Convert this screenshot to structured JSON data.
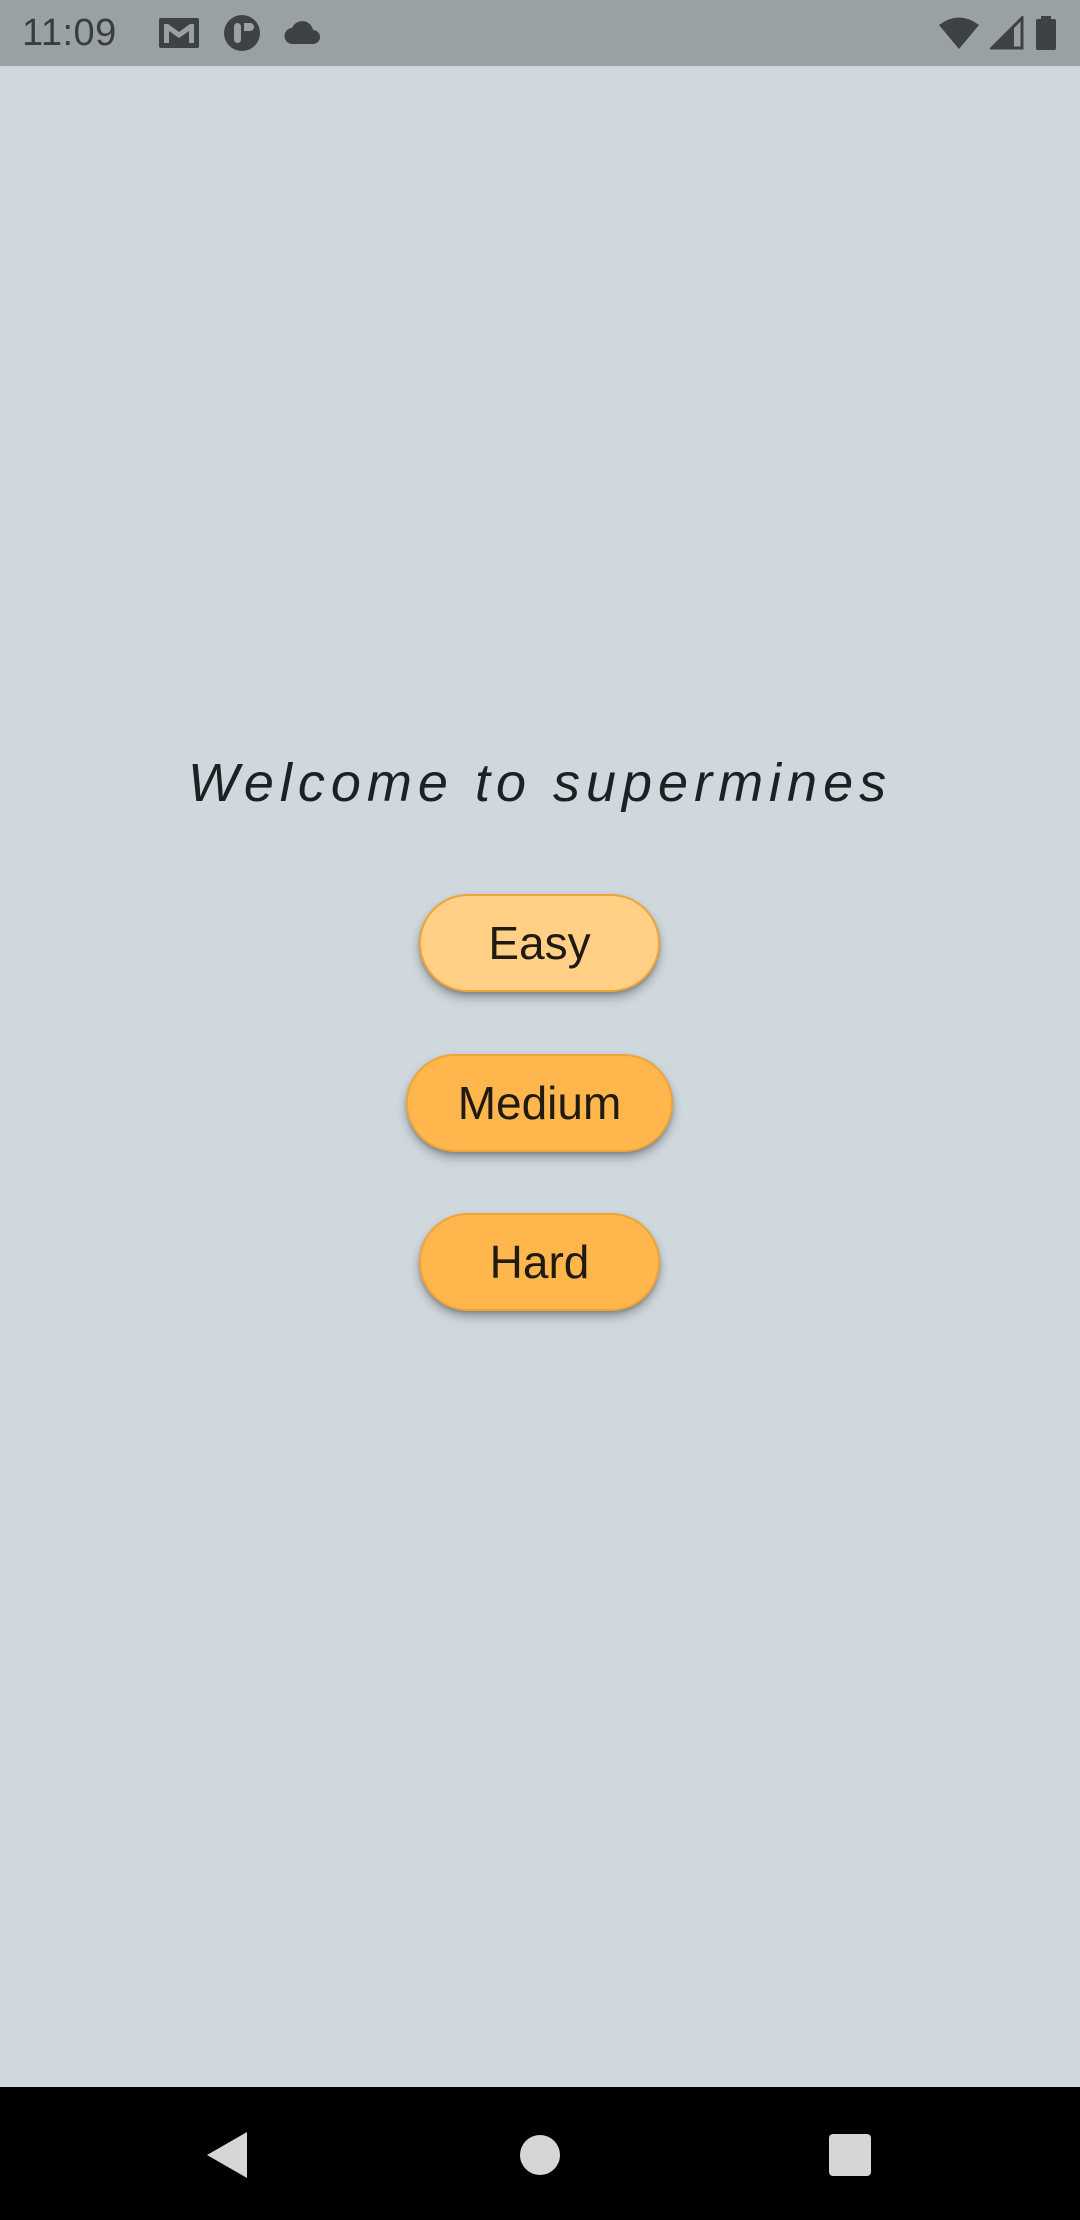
{
  "status_bar": {
    "time": "11:09",
    "left_icons": [
      "gmail-icon",
      "app-notification-icon",
      "cloud-icon"
    ],
    "right_icons": [
      "wifi-icon",
      "cell-signal-icon",
      "battery-icon"
    ]
  },
  "main": {
    "title": "Welcome to supermines",
    "buttons": {
      "easy": "Easy",
      "medium": "Medium",
      "hard": "Hard"
    }
  },
  "nav_bar": {
    "icons": [
      "back-icon",
      "home-icon",
      "recents-icon"
    ]
  },
  "colors": {
    "background": "#cfd8dd",
    "status_bar": "#9aa1a5",
    "button": "#ffb74d",
    "button_selected": "#ffd085",
    "button_border": "#f0a436",
    "nav_bar": "#000000"
  }
}
